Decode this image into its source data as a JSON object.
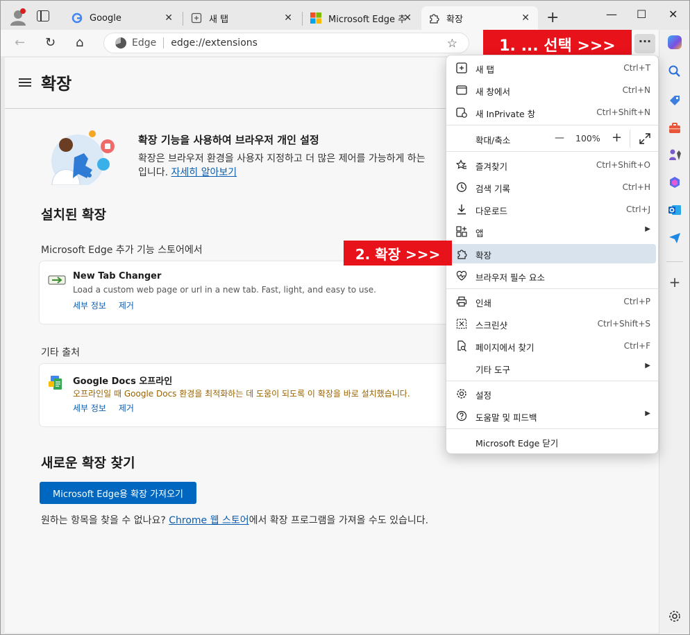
{
  "tabs": [
    {
      "title": "Google",
      "icon": "google-icon"
    },
    {
      "title": "새 탭",
      "icon": "new-tab-icon"
    },
    {
      "title": "Microsoft Edge 추가",
      "icon": "microsoft-icon"
    },
    {
      "title": "확장",
      "icon": "extension-icon"
    }
  ],
  "toolbar": {
    "site_label": "Edge",
    "url": "edge://extensions",
    "more_label": "···"
  },
  "callouts": {
    "step1": "1. ... 선택 >>>",
    "step2": "2. 확장 >>>"
  },
  "page": {
    "title": "확장",
    "hero_title": "확장 기능을 사용하여 브라우저 개인 설정",
    "hero_desc_line1": "확장은 브라우저 환경을 사용자 지정하고 더 많은 제어를 가능하게 하는",
    "hero_desc_line2_prefix": "입니다.",
    "hero_link": "자세히 알아보기",
    "installed_heading": "설치된 확장",
    "store_source": "Microsoft Edge 추가 기능 스토어에서",
    "other_source": "기타 출처",
    "new_heading": "새로운 확장 찾기",
    "get_button": "Microsoft Edge용 확장 가져오기",
    "footer_prefix": "원하는 항목을 찾을 수 없나요?",
    "footer_link": "Chrome 웹 스토어",
    "footer_suffix": "에서 확장 프로그램을 가져올 수도 있습니다."
  },
  "extensions": [
    {
      "name": "New Tab Changer",
      "desc": "Load a custom web page or url in a new tab. Fast, light, and easy to use.",
      "details": "세부 정보",
      "remove": "제거"
    },
    {
      "name": "Google Docs 오프라인",
      "desc": "오프라인일 때 Google Docs 환경을 최적화하는 데 도움이 되도록 이 확장을 바로 설치했습니다.",
      "details": "세부 정보",
      "remove": "제거"
    }
  ],
  "menu": {
    "new_tab": {
      "label": "새 탭",
      "shortcut": "Ctrl+T"
    },
    "new_window": {
      "label": "새 창에서",
      "shortcut": "Ctrl+N"
    },
    "new_inprivate": {
      "label": "새 InPrivate 창",
      "shortcut": "Ctrl+Shift+N"
    },
    "zoom": {
      "label": "확대/축소",
      "value": "100%",
      "minus": "—",
      "plus": "+"
    },
    "favorites": {
      "label": "즐겨찾기",
      "shortcut": "Ctrl+Shift+O"
    },
    "history": {
      "label": "검색 기록",
      "shortcut": "Ctrl+H"
    },
    "downloads": {
      "label": "다운로드",
      "shortcut": "Ctrl+J"
    },
    "apps": {
      "label": "앱"
    },
    "extensions": {
      "label": "확장"
    },
    "essentials": {
      "label": "브라우저 필수 요소"
    },
    "print": {
      "label": "인쇄",
      "shortcut": "Ctrl+P"
    },
    "screenshot": {
      "label": "스크린샷",
      "shortcut": "Ctrl+Shift+S"
    },
    "find": {
      "label": "페이지에서 찾기",
      "shortcut": "Ctrl+F"
    },
    "more_tools": {
      "label": "기타 도구"
    },
    "settings": {
      "label": "설정"
    },
    "help": {
      "label": "도움말 및 피드백"
    },
    "close_edge": {
      "label": "Microsoft Edge 닫기"
    }
  },
  "colors": {
    "callout": "#e8121b",
    "accent": "#0067c0",
    "highlight": "#d9e3ee"
  }
}
